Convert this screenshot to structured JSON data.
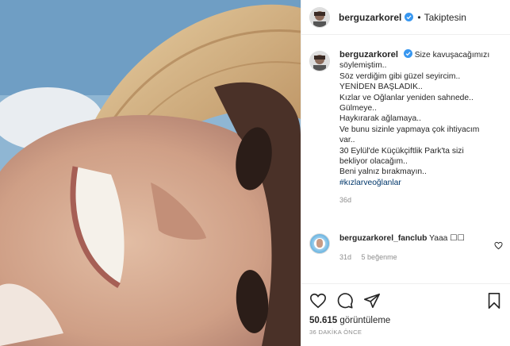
{
  "header": {
    "username": "berguzarkorel",
    "separator": "•",
    "follow_status": "Takiptesin"
  },
  "caption": {
    "username": "berguzarkorel",
    "lines": [
      "Size kavuşacağımızı",
      "söylemiştim..",
      "Söz verdiğim gibi güzel seyircim..",
      "YENİDEN BAŞLADIK..",
      "Kızlar ve Oğlanlar yeniden sahnede..",
      "Gülmeye..",
      "Haykırarak ağlamaya..",
      "Ve bunu sizinle yapmaya çok ihtiyacım",
      "var..",
      "30 Eylül'de Küçükçiftlik Park'ta sizi",
      "bekliyor olacağım..",
      "Beni yalnız bırakmayın..",
      "#kızlarveoğlanlar"
    ],
    "time": "36d"
  },
  "comment": {
    "username": "berguzarkorel_fanclub",
    "text": "Yaaa ☐☐",
    "time": "31d",
    "likes": "5 beğenme"
  },
  "actions": {
    "icons": [
      "heart-icon",
      "comment-icon",
      "share-icon",
      "bookmark-icon"
    ],
    "views_count": "50.615",
    "views_label": "görüntüleme",
    "posted_ago": "36 DAKİKA ÖNCE"
  },
  "colors": {
    "verified": "#3897f0",
    "hashtag": "#00376b",
    "muted": "#8e8e8e",
    "text": "#262626"
  }
}
